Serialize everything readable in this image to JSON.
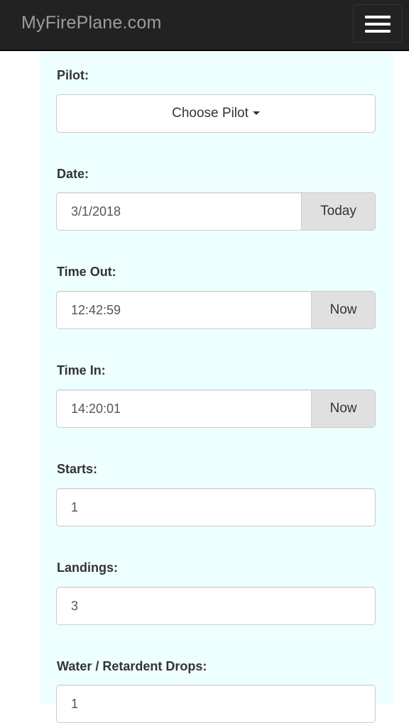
{
  "navbar": {
    "brand": "MyFirePlane.com",
    "menu_icon": "hamburger-menu-icon"
  },
  "form": {
    "pilot": {
      "label": "Pilot:",
      "dropdown_label": "Choose Pilot"
    },
    "date": {
      "label": "Date:",
      "value": "3/1/2018",
      "button": "Today"
    },
    "time_out": {
      "label": "Time Out:",
      "value": "12:42:59",
      "button": "Now"
    },
    "time_in": {
      "label": "Time In:",
      "value": "14:20:01",
      "button": "Now"
    },
    "starts": {
      "label": "Starts:",
      "value": "1"
    },
    "landings": {
      "label": "Landings:",
      "value": "3"
    },
    "drops": {
      "label": "Water / Retardent Drops:",
      "value": "1"
    }
  },
  "colors": {
    "navbar_bg": "#222222",
    "brand_text": "#9d9d9d",
    "panel_bg": "#eeffff",
    "addon_bg": "#e0e0e0"
  }
}
